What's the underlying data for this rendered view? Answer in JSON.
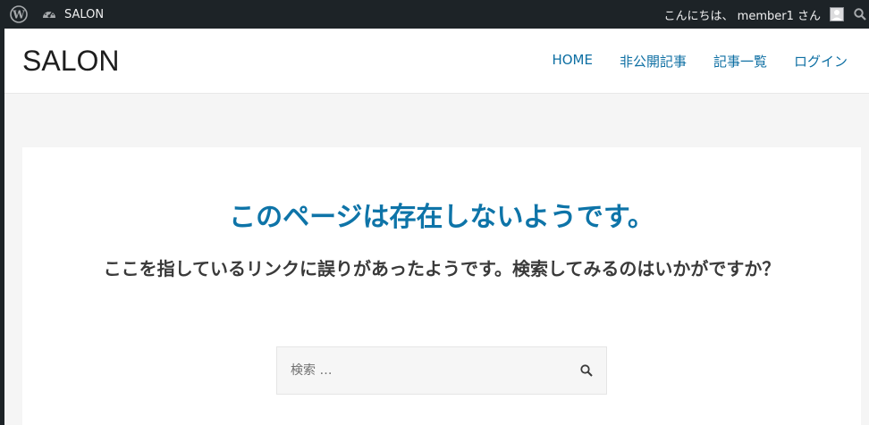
{
  "adminbar": {
    "site_name": "SALON",
    "greeting": "こんにちは、 member1 さん",
    "icons": [
      "wordpress-icon",
      "dashboard-icon",
      "avatar",
      "search-icon"
    ]
  },
  "header": {
    "logo": "SALON",
    "nav": [
      "HOME",
      "非公開記事",
      "記事一覧",
      "ログイン"
    ]
  },
  "main": {
    "title": "このページは存在しないようです。",
    "description": "ここを指しているリンクに誤りがあったようです。検索してみるのはいかがですか？",
    "search": {
      "placeholder": "検索 …",
      "value": ""
    }
  },
  "colors": {
    "adminbar_bg": "#1d2327",
    "link": "#0e6fa3",
    "title": "#0e74a8",
    "page_bg": "#f5f5f5"
  }
}
